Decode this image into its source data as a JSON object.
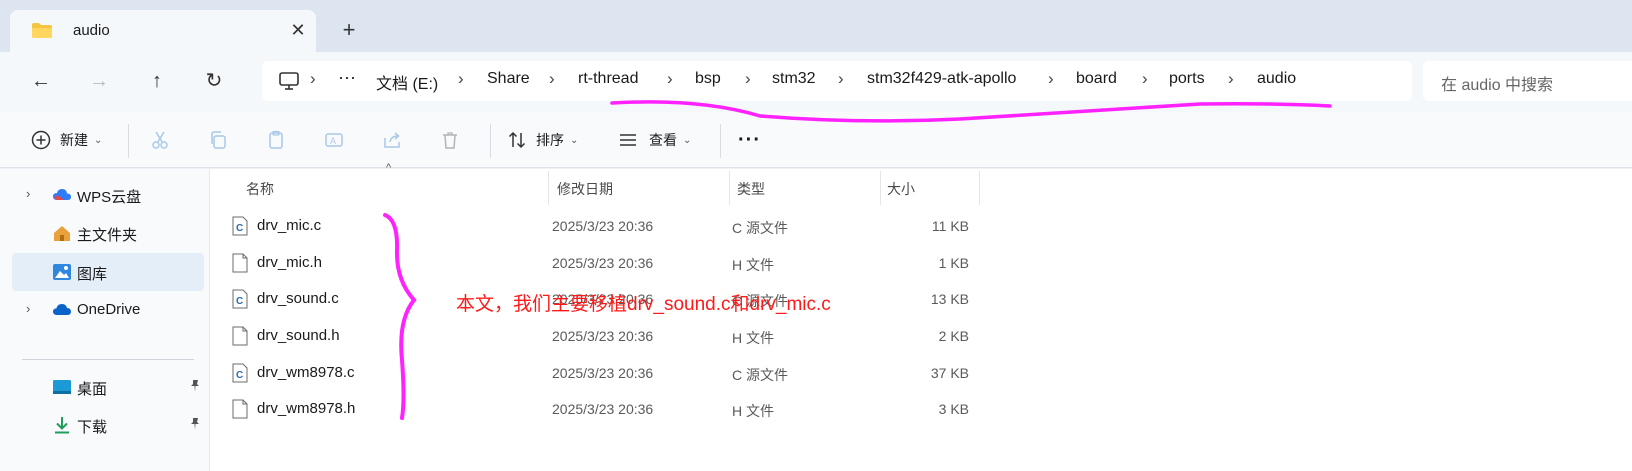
{
  "window": {
    "tab": {
      "title": "audio",
      "icon": "folder-icon",
      "close_icon": "close-icon"
    },
    "new_tab_icon": "plus-icon"
  },
  "navigation": {
    "back_icon": "arrow-left-icon",
    "forward_icon": "arrow-right-icon",
    "up_icon": "arrow-up-icon",
    "refresh_icon": "refresh-icon"
  },
  "address_bar": {
    "root_icon": "computer-icon",
    "overflow": "···",
    "breadcrumbs": [
      "文档 (E:)",
      "Share",
      "rt-thread",
      "bsp",
      "stm32",
      "stm32f429-atk-apollo",
      "board",
      "ports",
      "audio"
    ]
  },
  "search": {
    "placeholder": "在 audio 中搜索"
  },
  "toolbar": {
    "new_label": "新建",
    "sort_label": "排序",
    "view_label": "查看",
    "more_label": "···"
  },
  "sidebar": {
    "items": [
      {
        "label": "WPS云盘",
        "icon": "wps-cloud-icon",
        "expandable": true
      },
      {
        "label": "主文件夹",
        "icon": "home-icon",
        "expandable": false
      },
      {
        "label": "图库",
        "icon": "gallery-icon",
        "expandable": false,
        "selected": true
      },
      {
        "label": "OneDrive",
        "icon": "onedrive-icon",
        "expandable": true
      }
    ],
    "quick_access": [
      {
        "label": "桌面",
        "icon": "desktop-icon",
        "pinned": true
      },
      {
        "label": "下载",
        "icon": "download-icon",
        "pinned": true
      }
    ]
  },
  "file_list": {
    "columns": {
      "name": "名称",
      "modified": "修改日期",
      "type": "类型",
      "size": "大小"
    },
    "rows": [
      {
        "name": "drv_mic.c",
        "modified": "2025/3/23 20:36",
        "type": "C 源文件",
        "size": "11 KB",
        "icon": "c-source-file-icon"
      },
      {
        "name": "drv_mic.h",
        "modified": "2025/3/23 20:36",
        "type": "H 文件",
        "size": "1 KB",
        "icon": "header-file-icon"
      },
      {
        "name": "drv_sound.c",
        "modified": "2025/3/23 20:36",
        "type": "C 源文件",
        "size": "13 KB",
        "icon": "c-source-file-icon"
      },
      {
        "name": "drv_sound.h",
        "modified": "2025/3/23 20:36",
        "type": "H 文件",
        "size": "2 KB",
        "icon": "header-file-icon"
      },
      {
        "name": "drv_wm8978.c",
        "modified": "2025/3/23 20:36",
        "type": "C 源文件",
        "size": "37 KB",
        "icon": "c-source-file-icon"
      },
      {
        "name": "drv_wm8978.h",
        "modified": "2025/3/23 20:36",
        "type": "H 文件",
        "size": "3 KB",
        "icon": "header-file-icon"
      }
    ]
  },
  "annotation": {
    "text": "本文，我们主要移植drv_sound.c和drv_mic.c",
    "color": "#ff1a1a",
    "marker_color": "#ff22ff"
  }
}
